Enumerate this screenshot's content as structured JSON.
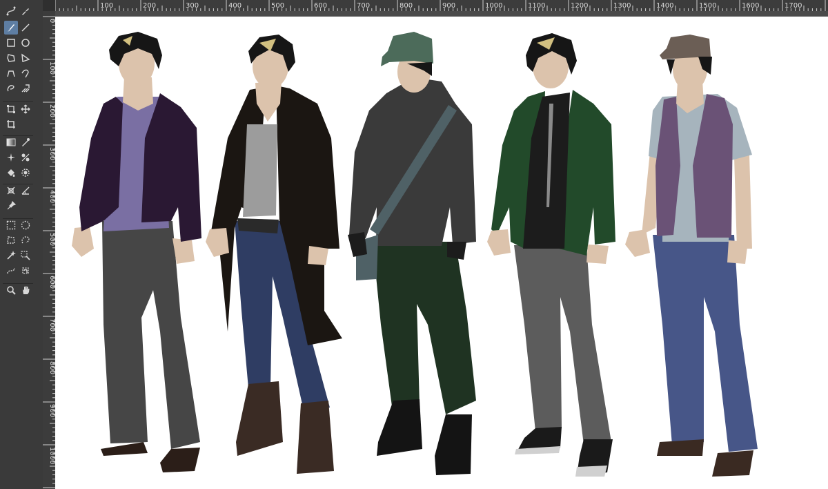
{
  "app": {
    "name": "Image editor"
  },
  "toolbox": {
    "tools": [
      {
        "id": "bezier-select",
        "icon": "bezier-select-icon"
      },
      {
        "id": "ink",
        "icon": "pen-icon"
      },
      {
        "id": "paintbrush",
        "icon": "brush-icon",
        "active": true
      },
      {
        "id": "line",
        "icon": "line-icon"
      },
      {
        "id": "rectangle",
        "icon": "rectangle-icon"
      },
      {
        "id": "ellipse",
        "icon": "ellipse-icon"
      },
      {
        "id": "polygon",
        "icon": "polygon-icon"
      },
      {
        "id": "triangle",
        "icon": "triangle-icon"
      },
      {
        "id": "curve",
        "icon": "curve-icon"
      },
      {
        "id": "freehand",
        "icon": "freehand-icon"
      },
      {
        "id": "lasso",
        "icon": "lasso-icon"
      },
      {
        "id": "multibrush",
        "icon": "multibrush-icon"
      },
      {
        "id": "transform",
        "icon": "transform-icon"
      },
      {
        "id": "move",
        "icon": "move-icon"
      },
      {
        "id": "crop",
        "icon": "crop-icon"
      },
      {
        "id": "gradient",
        "icon": "gradient-icon"
      },
      {
        "id": "color-picker",
        "icon": "eyedropper-icon"
      },
      {
        "id": "smart-patch",
        "icon": "sparkle-icon"
      },
      {
        "id": "colorize",
        "icon": "colorize-icon"
      },
      {
        "id": "fill",
        "icon": "bucket-icon"
      },
      {
        "id": "enclose-fill",
        "icon": "enclose-fill-icon"
      },
      {
        "id": "assistant",
        "icon": "assistant-icon"
      },
      {
        "id": "measure",
        "icon": "measure-icon"
      },
      {
        "id": "reference",
        "icon": "pin-icon"
      },
      {
        "id": "rect-select",
        "icon": "rect-select-icon"
      },
      {
        "id": "ellipse-select",
        "icon": "ellipse-select-icon"
      },
      {
        "id": "polygon-select",
        "icon": "polygon-select-icon"
      },
      {
        "id": "freehand-select",
        "icon": "freehand-select-icon"
      },
      {
        "id": "contiguous-select",
        "icon": "magic-wand-icon"
      },
      {
        "id": "similar-select",
        "icon": "similar-select-icon"
      },
      {
        "id": "path-select",
        "icon": "path-select-icon"
      },
      {
        "id": "magnetic-select",
        "icon": "magnetic-select-icon"
      },
      {
        "id": "zoom",
        "icon": "zoom-icon"
      },
      {
        "id": "pan",
        "icon": "hand-icon"
      }
    ]
  },
  "rulers": {
    "horizontal": [
      "100",
      "200",
      "300",
      "400",
      "500",
      "600",
      "700",
      "800",
      "900",
      "1000",
      "1100",
      "1200",
      "1300",
      "1400",
      "1500",
      "1600",
      "1700"
    ],
    "vertical": [
      "0",
      "100",
      "200",
      "300",
      "400",
      "500",
      "600",
      "700",
      "800",
      "900",
      "1000"
    ]
  },
  "canvas": {
    "background": "#ffffff",
    "characters": [
      {
        "name": "figure-1",
        "hair": "#161616",
        "jacket": "#2a1833",
        "shirt": "#7a6fa3",
        "pants": "#464646",
        "shoes": "#2b1e18"
      },
      {
        "name": "figure-2",
        "hair": "#161616",
        "coat": "#1b1612",
        "shirt": "#9c9c9c",
        "pants": "#2f3d63",
        "boots": "#3a2b24"
      },
      {
        "name": "figure-3",
        "cap": "#4c6b5a",
        "hoodie": "#3a3a3a",
        "strap": "#4f6166",
        "pants": "#1f3322",
        "boots": "#141414"
      },
      {
        "name": "figure-4",
        "hair": "#161616",
        "jacket": "#224a2a",
        "shirt": "#1c1c1c",
        "pants": "#5c5c5c",
        "shoes": "#1a1a1a"
      },
      {
        "name": "figure-5",
        "cap": "#6b5e55",
        "shirt": "#a6b4bd",
        "vest": "#6a5276",
        "pants": "#475688",
        "shoes": "#3a2a22"
      }
    ],
    "skin": "#dcc3ac",
    "hair_highlight": "#d2c080"
  }
}
